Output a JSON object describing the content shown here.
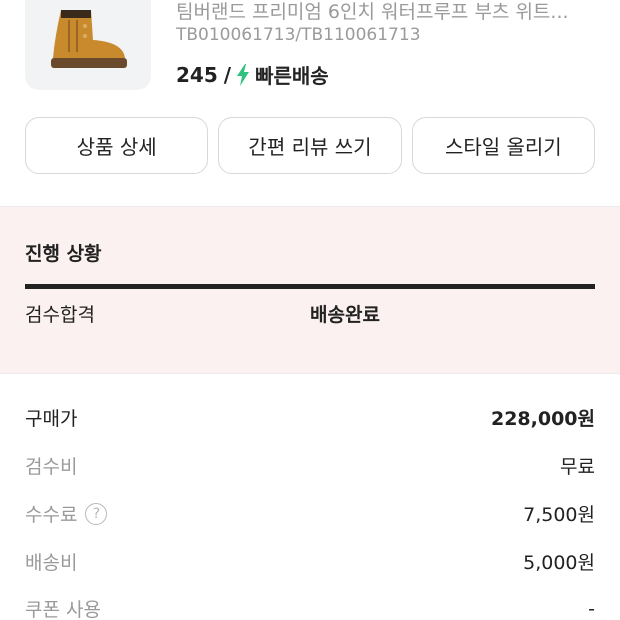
{
  "product": {
    "image": "boot-image",
    "name": "팀버랜드 프리미엄 6인치 워터프루프 부츠 위트...",
    "code": "TB010061713/TB110061713",
    "size": "245",
    "slash": "/",
    "shipping_icon": "lightning-bolt-icon",
    "shipping_label": "빠른배송",
    "shipping_color": "#2ec27e"
  },
  "actions": [
    {
      "label": "상품 상세"
    },
    {
      "label": "간편 리뷰 쓰기"
    },
    {
      "label": "스타일 올리기"
    }
  ],
  "progress": {
    "title": "진행 상황",
    "steps": [
      "검수합격",
      "배송완료"
    ],
    "current_step": "배송완료",
    "completion": 1.0,
    "background": "#fcf1f1"
  },
  "summary": {
    "rows": [
      {
        "label": "구매가",
        "value": "228,000원"
      },
      {
        "label": "검수비",
        "value": "무료"
      },
      {
        "label": "수수료",
        "value": "7,500원",
        "help_icon": "?"
      },
      {
        "label": "배송비",
        "value": "5,000원"
      },
      {
        "label": "쿠폰 사용",
        "value": "-"
      }
    ]
  }
}
